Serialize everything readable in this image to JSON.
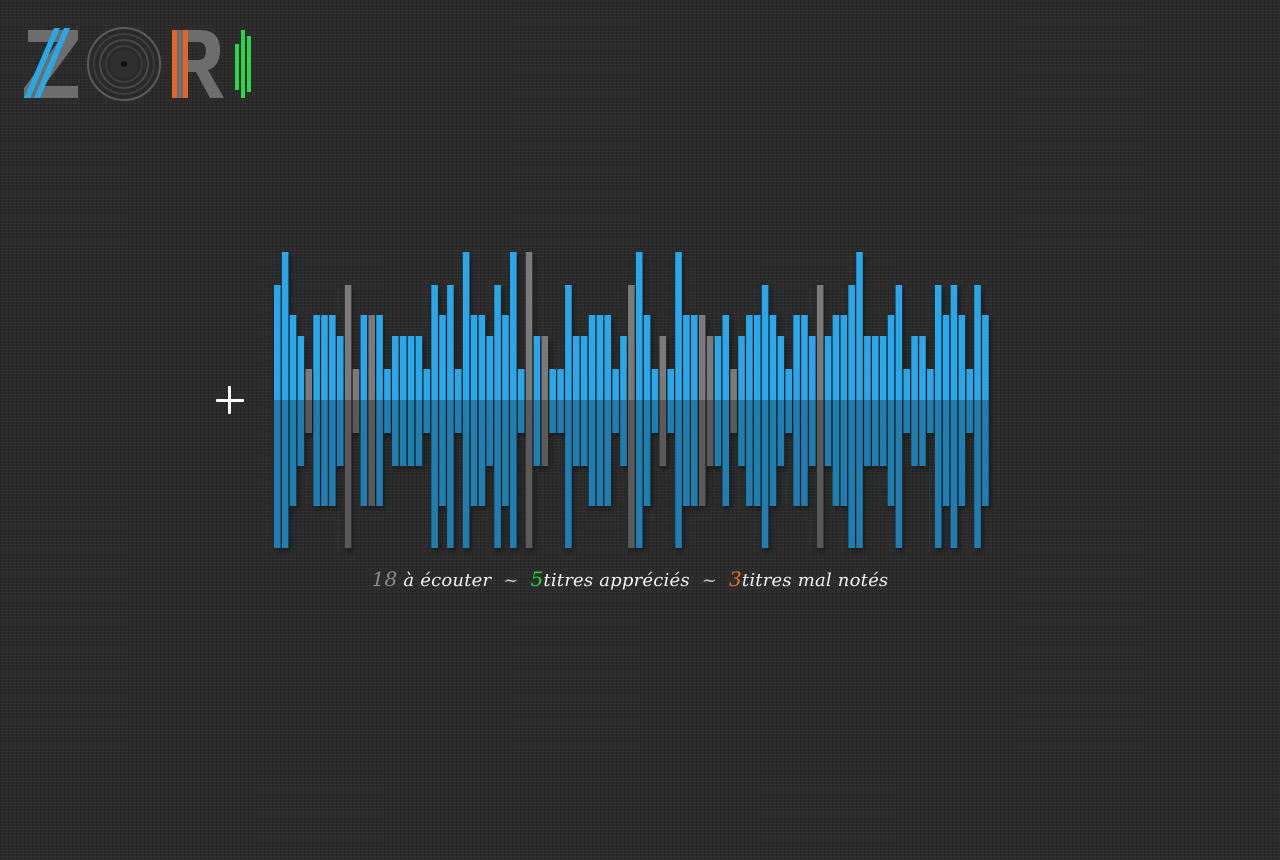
{
  "logo": {
    "alt": "ZORI",
    "colors": {
      "blue": "#29a8e6",
      "grey": "#707070",
      "orange": "#e8622a",
      "green": "#2bd44a"
    }
  },
  "add_button": {
    "icon": "plus-icon",
    "color": "#ffffff"
  },
  "waveform": {
    "colors": {
      "played": "#2aa7e8",
      "played_reflection": "#1f7db0",
      "unrated": "#7a7a7a",
      "unrated_reflection": "#5a5a5a"
    },
    "levels": [
      4,
      5,
      3,
      2,
      1,
      3,
      3,
      3,
      2,
      4,
      1,
      3,
      3,
      3,
      1,
      2,
      2,
      2,
      2,
      1,
      4,
      3,
      4,
      1,
      5,
      3,
      3,
      2,
      4,
      3,
      5,
      1,
      5,
      2,
      2,
      1,
      1,
      4,
      2,
      2,
      3,
      3,
      3,
      1,
      2,
      4,
      5,
      3,
      1,
      2,
      1,
      5,
      3,
      3,
      3,
      2,
      2,
      3,
      1,
      2,
      3,
      3,
      4,
      3,
      2,
      1,
      3,
      3,
      2,
      4,
      2,
      3,
      3,
      4,
      5,
      2,
      2,
      2,
      3,
      4,
      1,
      2,
      2,
      1,
      4,
      3,
      4,
      3,
      1,
      4,
      3
    ],
    "grey_indices": [
      4,
      9,
      10,
      12,
      32,
      34,
      45,
      49,
      54,
      55,
      58,
      69
    ]
  },
  "stats": {
    "to_listen_count": "18",
    "to_listen_label": "à écouter",
    "separator": "~",
    "liked_count": "5",
    "liked_label": "titres appréciés",
    "disliked_count": "3",
    "disliked_label": "titres mal notés"
  }
}
